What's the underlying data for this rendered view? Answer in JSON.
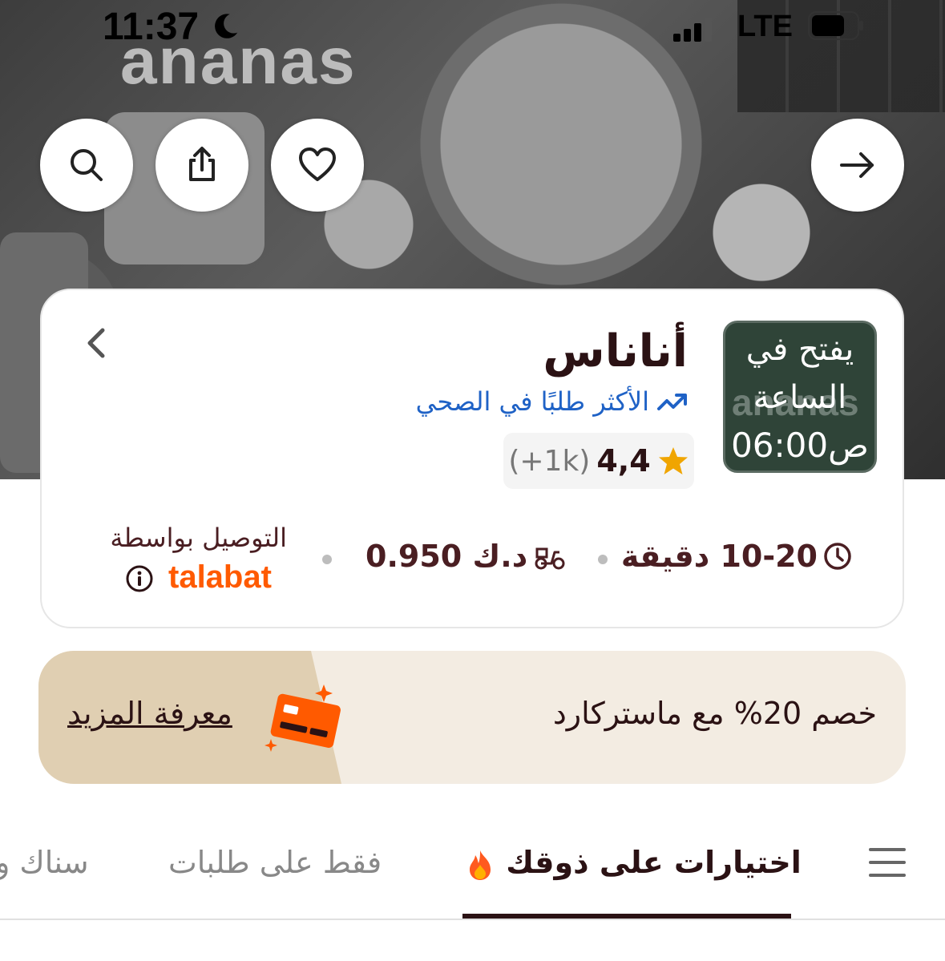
{
  "status_bar": {
    "time": "11:37",
    "network": "LTE"
  },
  "hero": {
    "brand_watermark": "ananas"
  },
  "restaurant": {
    "name": "أناناس",
    "popular_tag": "الأكثر طلبًا في الصحي",
    "rating": "4,4",
    "rating_count": "(+1k)",
    "opens_line1": "يفتح في",
    "opens_line2": "الساعة",
    "opens_line3": "06:00ص",
    "logo_watermark": "ananas"
  },
  "delivery": {
    "time": "10-20 دقيقة",
    "fee": "0.950 د.ك",
    "by_label": "التوصيل بواسطة",
    "provider": "talabat"
  },
  "promo": {
    "text": "خصم 20% مع ماستركارد",
    "link": "معرفة المزيد"
  },
  "tabs": [
    {
      "label": "اختيارات على ذوقك",
      "active": true
    },
    {
      "label": "فقط على طلبات",
      "active": false
    },
    {
      "label": "سناك و",
      "active": false
    }
  ],
  "colors": {
    "brand_orange": "#ff5a00",
    "link_blue": "#1f62c6",
    "text_dark": "#2b1214",
    "logo_bg": "#2f4438",
    "promo_bg": "#f3ece2"
  },
  "icons": {
    "back": "arrow-right-icon",
    "favorite": "heart-icon",
    "share": "share-icon",
    "search": "search-icon",
    "menu": "menu-icon"
  }
}
